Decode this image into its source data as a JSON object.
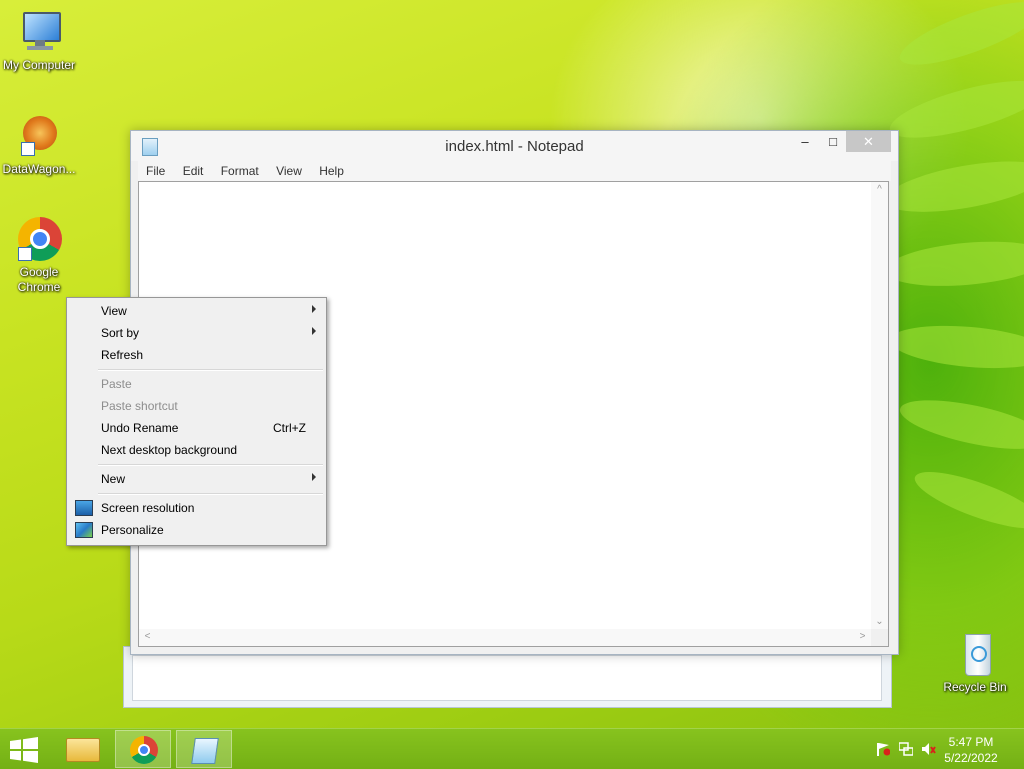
{
  "desktop": {
    "icons": [
      {
        "label": "My Computer"
      },
      {
        "label": "DataWagon..."
      },
      {
        "label": "Google Chrome"
      },
      {
        "label": "Recycle Bin"
      }
    ]
  },
  "notepad": {
    "title": "index.html - Notepad",
    "menu": [
      "File",
      "Edit",
      "Format",
      "View",
      "Help"
    ],
    "content": "",
    "buttons": {
      "minimize": "–",
      "maximize": "□",
      "close": "✕"
    }
  },
  "context_menu": {
    "items": [
      {
        "label": "View",
        "submenu": true
      },
      {
        "label": "Sort by",
        "submenu": true
      },
      {
        "label": "Refresh"
      },
      {
        "label": "Paste",
        "disabled": true
      },
      {
        "label": "Paste shortcut",
        "disabled": true
      },
      {
        "label": "Undo Rename",
        "shortcut": "Ctrl+Z"
      },
      {
        "label": "Next desktop background"
      },
      {
        "label": "New",
        "submenu": true
      },
      {
        "label": "Screen resolution",
        "icon": "screen-resolution-icon"
      },
      {
        "label": "Personalize",
        "icon": "personalize-icon"
      }
    ]
  },
  "taskbar": {
    "clock": {
      "time": "5:47 PM",
      "date": "5/22/2022"
    }
  }
}
